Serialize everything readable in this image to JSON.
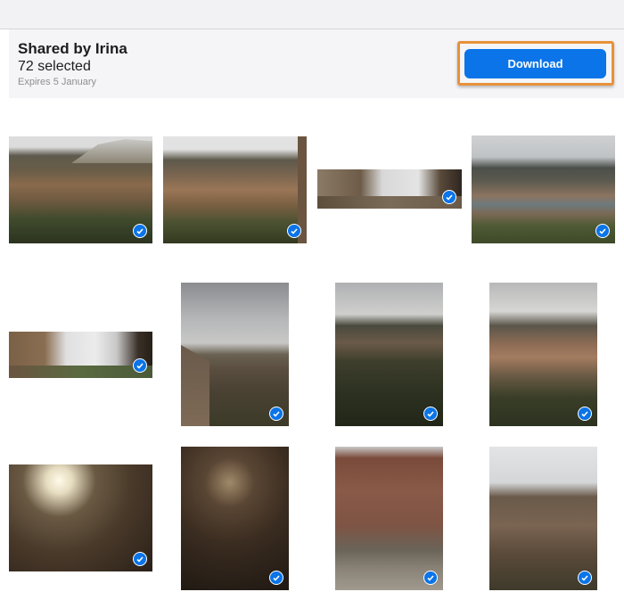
{
  "header": {
    "title": "Shared by Irina",
    "selected": "72 selected",
    "expires": "Expires 5 January"
  },
  "actions": {
    "download_label": "Download"
  },
  "colors": {
    "accent": "#0a74e8",
    "highlight": "#e8923a"
  },
  "photos": [
    {
      "name": "hillside-town-view-1",
      "selected": true
    },
    {
      "name": "hillside-town-view-2",
      "selected": true
    },
    {
      "name": "castle-panorama",
      "selected": true
    },
    {
      "name": "river-valley-view",
      "selected": true
    },
    {
      "name": "castle-courtyard-panorama",
      "selected": true
    },
    {
      "name": "tower-and-wall",
      "selected": true
    },
    {
      "name": "town-overlook-1",
      "selected": true
    },
    {
      "name": "town-overlook-2",
      "selected": true
    },
    {
      "name": "wine-barrel-lit",
      "selected": true
    },
    {
      "name": "wine-barrel-dark",
      "selected": true
    },
    {
      "name": "castle-facade",
      "selected": true
    },
    {
      "name": "castle-ruins",
      "selected": true
    }
  ]
}
